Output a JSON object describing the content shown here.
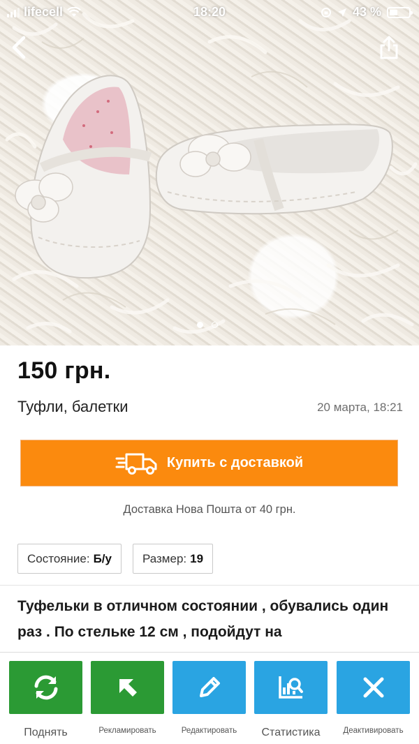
{
  "status_bar": {
    "carrier": "lifecell",
    "time": "18:20",
    "battery_percent": "43 %",
    "battery_level": 0.43
  },
  "gallery": {
    "image_count": 2,
    "active_index": 0
  },
  "listing": {
    "price": "150 грн.",
    "title": "Туфли, балетки",
    "date": "20 марта, 18:21",
    "buy_button_label": "Купить с доставкой",
    "delivery_note": "Доставка Нова Пошта от 40 грн.",
    "params": [
      {
        "label": "Состояние:",
        "value": "Б/у"
      },
      {
        "label": "Размер:",
        "value": "19"
      }
    ],
    "description": "Туфельки в отличном состоянии , обувались один раз . По стельке 12 см , подойдут на"
  },
  "toolbar": {
    "items": [
      {
        "label": "Поднять",
        "icon": "refresh-icon",
        "color": "#2b9a34"
      },
      {
        "label": "Рекламировать",
        "icon": "arrow-up-left-icon",
        "color": "#2b9a34"
      },
      {
        "label": "Редактировать",
        "icon": "pencil-icon",
        "color": "#2aa4e2"
      },
      {
        "label": "Статистика",
        "icon": "stats-icon",
        "color": "#2aa4e2"
      },
      {
        "label": "Деактивировать",
        "icon": "close-icon",
        "color": "#2aa4e2"
      }
    ]
  },
  "colors": {
    "buy_button": "#fb8a0e",
    "green_button": "#2b9a34",
    "blue_button": "#2aa4e2"
  }
}
